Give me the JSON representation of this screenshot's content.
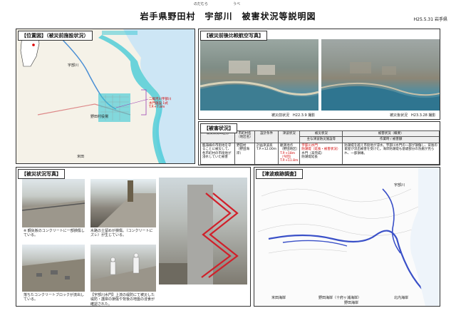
{
  "header": {
    "title": "岩手県野田村　宇部川　被害状況等説明図",
    "ruby_noda": "のだむら",
    "ruby_ube": "うべ",
    "date": "H25.5.31",
    "org": "岩手県"
  },
  "panels": {
    "location": {
      "title": "【位置図】（被災前施設状況）"
    },
    "aerial": {
      "title": "【被災前後比較航空写真】",
      "before_caption": "被災前状況　H22.3.9 撮影",
      "after_caption": "被災後状況　H23.3.28 撮影"
    },
    "damage": {
      "title": "【被害状況】"
    },
    "photos": {
      "title": "【被災状況写真】"
    },
    "tsunami": {
      "title": "【津波痕跡調査】"
    }
  },
  "location_map": {
    "annotation": [
      "二級河川宇部川",
      "水門施設 1式",
      "T.P.+7.8m"
    ],
    "labels": [
      "野田村役場",
      "宇部川",
      "米田"
    ]
  },
  "damage_table": {
    "headers": [
      "被災状況の区分",
      "市町村名\n（地区名）",
      "設計条件",
      "津波状況",
      "被災状況",
      "被害状況（概要）"
    ],
    "subheaders": [
      "",
      "",
      "",
      "",
      "主な津波防災施設等",
      "作業時 / 被害額"
    ],
    "row": {
      "category": "臨海線の市街地を守ることに被災して、各市町村の市街地が浸水していた被害",
      "municipality": "野田村\n（野田海岸）",
      "design": "計画津波高\nT.P.+12.00m",
      "tsunami_a": "観測地点\n（野田地区）",
      "tsunami_b": "T.P.+18m\n（今回）\nT.P.+11.8m",
      "facility": [
        "宇部川水門",
        "防潮堤（延長・被害状況）",
        "水門（未完成）",
        "防潮堤延長",
        "河口部浸水"
      ],
      "summary": "防潮堤を越え市街地が浸水。宇部川水門の一部が損傷し、背後の家屋が流出被害を受けた。海岸防潮堤も基礎部分の洗掘が見られ、一部損壊。"
    }
  },
  "photo_captions": [
    "※ 鋼矢板のコンクリートに一部損傷している。",
    "水路の土留めが損傷。（コンクリートにズレ）が生じている。",
    "",
    "落ちたコンクリートブロックが流出している。",
    "【宇部川水門】上流の堤防にて被災した堤防・護岸の損傷や背後の地盤の浸食が確認された。"
  ],
  "tsunami_labels": [
    "宇部川",
    "米田海岸",
    "野田海岸（十府ヶ浦海岸）",
    "野田海岸",
    "北内海岸"
  ]
}
